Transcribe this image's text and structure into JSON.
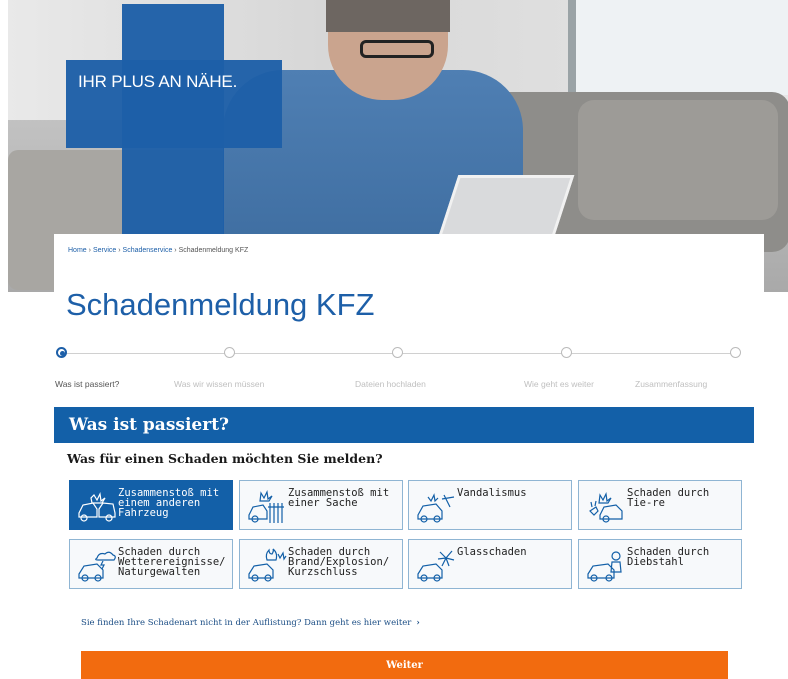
{
  "hero": {
    "slogan": "IHR PLUS AN NÄHE."
  },
  "breadcrumb": {
    "items": [
      "Home",
      "Service",
      "Schadenservice",
      "Schadenmeldung KFZ"
    ],
    "separator": "›"
  },
  "page_title": "Schadenmeldung KFZ",
  "stepper": {
    "steps": [
      {
        "label": "Was ist passiert?"
      },
      {
        "label": "Was wir wissen müssen"
      },
      {
        "label": "Dateien hochladen"
      },
      {
        "label": "Wie geht es weiter"
      },
      {
        "label": "Zusammenfassung"
      }
    ],
    "active_index": 0
  },
  "section": {
    "heading": "Was ist passiert?",
    "question": "Was für einen Schaden möchten Sie melden?"
  },
  "damage_types": [
    {
      "label": "Zusammenstoß mit einem anderen Fahrzeug",
      "icon": "car-collision-icon"
    },
    {
      "label": "Zusammenstoß mit einer Sache",
      "icon": "car-object-collision-icon"
    },
    {
      "label": "Vandalismus",
      "icon": "vandalism-icon"
    },
    {
      "label": "Schaden durch Tie-re",
      "icon": "animal-damage-icon"
    },
    {
      "label": "Schaden durch Wetterereignisse/ Naturgewalten",
      "icon": "weather-damage-icon"
    },
    {
      "label": "Schaden durch Brand/Explosion/ Kurzschluss",
      "icon": "fire-damage-icon"
    },
    {
      "label": "Glasschaden",
      "icon": "glass-damage-icon"
    },
    {
      "label": "Schaden durch Diebstahl",
      "icon": "theft-icon"
    }
  ],
  "selected_damage_index": 0,
  "more_link": {
    "label": "Sie finden Ihre Schadenart nicht in der Auflistung? Dann geht es hier weiter",
    "chevron": "›"
  },
  "primary_button": {
    "label": "Weiter"
  },
  "colors": {
    "brand_blue": "#1360a8",
    "cta_orange": "#f26b0f",
    "tile_border": "#8fb5d3"
  }
}
